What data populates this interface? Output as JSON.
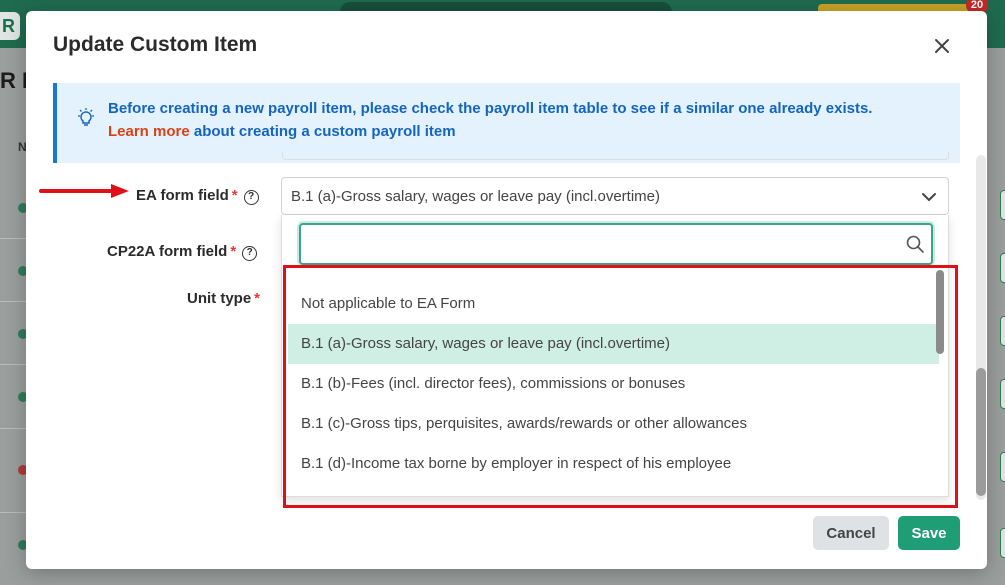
{
  "background": {
    "logo_letter": "R",
    "page_title": "R L",
    "column_header": "N",
    "notification_count": "20"
  },
  "modal": {
    "title": "Update Custom Item",
    "info": {
      "text_before": "Before creating a new payroll item, please check the payroll item table to see if a similar one already exists. ",
      "link_text": "Learn more",
      "text_after": " about creating a custom payroll item"
    },
    "fields": {
      "ea_form_label": "EA form field",
      "cp22a_label": "CP22A form field",
      "unit_type_label": "Unit type",
      "required_mark": "*",
      "help_glyph": "?"
    },
    "ea_select": {
      "value": "B.1 (a)-Gross salary, wages or leave pay (incl.overtime)",
      "search_placeholder": "",
      "options": [
        "Not applicable to EA Form",
        "B.1 (a)-Gross salary, wages or leave pay (incl.overtime)",
        "B.1 (b)-Fees (incl. director fees), commissions or bonuses",
        "B.1 (c)-Gross tips, perquisites, awards/rewards or other allowances",
        "B.1 (d)-Income tax borne by employer in respect of his employee"
      ],
      "selected_index": 1
    },
    "buttons": {
      "cancel": "Cancel",
      "save": "Save"
    }
  },
  "colors": {
    "primary": "#1f9d74",
    "info_text": "#1565c0",
    "link": "#d84315",
    "highlight": "#e0101a",
    "selected_row": "#cfeee4"
  }
}
